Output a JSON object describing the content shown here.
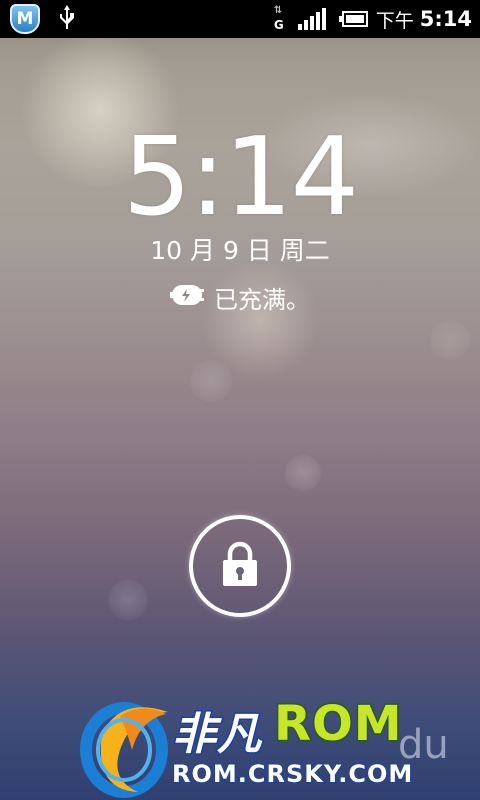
{
  "status_bar": {
    "left_icons": [
      "app-badge-icon",
      "usb-icon"
    ],
    "app_badge_letter": "M",
    "network_type": "G",
    "time_prefix": "下午",
    "time": "5:14"
  },
  "lockscreen": {
    "clock": "5:14",
    "date": "10 月 9 日 周二",
    "charging_status": "已充满。",
    "charging_icon": "plug-icon",
    "unlock_icon": "lock-icon"
  },
  "watermark": {
    "brand_cn": "非凡",
    "brand_rom": "ROM",
    "url": "ROM.CRSKY.COM",
    "partial_text": "du"
  },
  "colors": {
    "status_bar_bg": "#000000",
    "rom_green": "#c6e62a",
    "brand_blue": "#1b3fa8"
  }
}
